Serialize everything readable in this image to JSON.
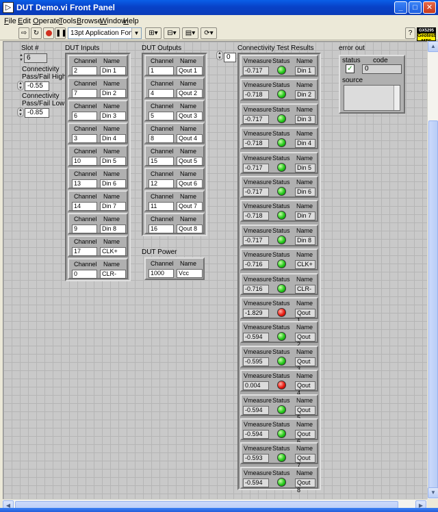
{
  "window": {
    "title": "DUT Demo.vi Front Panel",
    "minimize": "_",
    "maximize": "□",
    "close": "✕"
  },
  "menu": [
    "File",
    "Edit",
    "Operate",
    "Tools",
    "Browse",
    "Window",
    "Help"
  ],
  "toolbar": {
    "font": "13pt Application Font",
    "help": "?",
    "badge_top": "GX5295",
    "badge_line1": "Geotest",
    "badge_line2": "MTS"
  },
  "slot": {
    "label": "Slot #",
    "value": "6"
  },
  "high": {
    "label_line1": "Connectivity",
    "label_line2": "Pass/Fail High",
    "value": "-0.55"
  },
  "low": {
    "label_line1": "Connectivity",
    "label_line2": "Pass/Fail Low",
    "value": "-0.85"
  },
  "headers": {
    "channel": "Channel",
    "name": "Name",
    "vmeasure": "Vmeasure",
    "status": "Status"
  },
  "inputs": {
    "label": "DUT Inputs",
    "rows": [
      {
        "channel": "2",
        "name": "Din 1"
      },
      {
        "channel": "7",
        "name": "Din 2"
      },
      {
        "channel": "6",
        "name": "Din 3"
      },
      {
        "channel": "3",
        "name": "Din 4"
      },
      {
        "channel": "10",
        "name": "Din 5"
      },
      {
        "channel": "13",
        "name": "Din 6"
      },
      {
        "channel": "14",
        "name": "Din 7"
      },
      {
        "channel": "9",
        "name": "Din 8"
      },
      {
        "channel": "17",
        "name": "CLK+"
      },
      {
        "channel": "0",
        "name": "CLR-"
      }
    ]
  },
  "outputs": {
    "label": "DUT Outputs",
    "rows": [
      {
        "channel": "1",
        "name": "Qout 1"
      },
      {
        "channel": "4",
        "name": "Qout 2"
      },
      {
        "channel": "5",
        "name": "Qout 3"
      },
      {
        "channel": "8",
        "name": "Qout 4"
      },
      {
        "channel": "15",
        "name": "Qout 5"
      },
      {
        "channel": "12",
        "name": "Qout 6"
      },
      {
        "channel": "11",
        "name": "Qout 7"
      },
      {
        "channel": "16",
        "name": "Qout 8"
      }
    ]
  },
  "power": {
    "label": "DUT Power",
    "channel": "1000",
    "name": "Vcc"
  },
  "results": {
    "label": "Connectivity Test Results",
    "index": "0",
    "rows": [
      {
        "vmeasure": "-0.717",
        "status": "pass",
        "name": "Din 1"
      },
      {
        "vmeasure": "-0.718",
        "status": "pass",
        "name": "Din 2"
      },
      {
        "vmeasure": "-0.717",
        "status": "pass",
        "name": "Din 3"
      },
      {
        "vmeasure": "-0.718",
        "status": "pass",
        "name": "Din 4"
      },
      {
        "vmeasure": "-0.717",
        "status": "pass",
        "name": "Din 5"
      },
      {
        "vmeasure": "-0.717",
        "status": "pass",
        "name": "Din 6"
      },
      {
        "vmeasure": "-0.718",
        "status": "pass",
        "name": "Din 7"
      },
      {
        "vmeasure": "-0.717",
        "status": "pass",
        "name": "Din 8"
      },
      {
        "vmeasure": "-0.716",
        "status": "pass",
        "name": "CLK+"
      },
      {
        "vmeasure": "-0.716",
        "status": "pass",
        "name": "CLR-"
      },
      {
        "vmeasure": "-1.829",
        "status": "fail",
        "name": "Qout 1"
      },
      {
        "vmeasure": "-0.594",
        "status": "pass",
        "name": "Qout 2"
      },
      {
        "vmeasure": "-0.595",
        "status": "pass",
        "name": "Qout 3"
      },
      {
        "vmeasure": "0.004",
        "status": "fail",
        "name": "Qout 4"
      },
      {
        "vmeasure": "-0.594",
        "status": "pass",
        "name": "Qout 5"
      },
      {
        "vmeasure": "-0.594",
        "status": "pass",
        "name": "Qout 6"
      },
      {
        "vmeasure": "-0.593",
        "status": "pass",
        "name": "Qout 7"
      },
      {
        "vmeasure": "-0.594",
        "status": "pass",
        "name": "Qout 8"
      }
    ]
  },
  "error_out": {
    "label": "error out",
    "status_label": "status",
    "code_label": "code",
    "code_value": "0",
    "status_check": "✓",
    "source_label": "source"
  },
  "colors": {
    "pass_led": "#24c81a",
    "fail_led": "#e81a10",
    "panel": "#c9c9c9"
  }
}
